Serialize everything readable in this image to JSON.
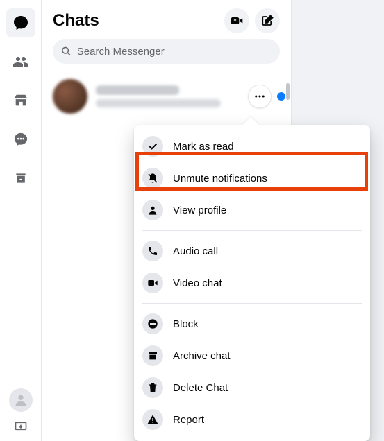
{
  "rail": {
    "items": [
      {
        "name": "chat-icon"
      },
      {
        "name": "people-icon"
      },
      {
        "name": "marketplace-icon"
      },
      {
        "name": "requests-icon"
      },
      {
        "name": "archive-icon"
      }
    ]
  },
  "header": {
    "title": "Chats"
  },
  "search": {
    "placeholder": "Search Messenger"
  },
  "chat": {
    "unread": true
  },
  "menu": {
    "items": [
      {
        "icon": "check-icon",
        "label": "Mark as read"
      },
      {
        "icon": "bell-slash-icon",
        "label": "Unmute notifications",
        "highlighted": true
      },
      {
        "icon": "profile-icon",
        "label": "View profile"
      },
      {
        "divider": true
      },
      {
        "icon": "phone-icon",
        "label": "Audio call"
      },
      {
        "icon": "video-icon",
        "label": "Video chat"
      },
      {
        "divider": true
      },
      {
        "icon": "block-icon",
        "label": "Block"
      },
      {
        "icon": "archive-icon",
        "label": "Archive chat"
      },
      {
        "icon": "trash-icon",
        "label": "Delete Chat"
      },
      {
        "icon": "warning-icon",
        "label": "Report"
      }
    ]
  }
}
